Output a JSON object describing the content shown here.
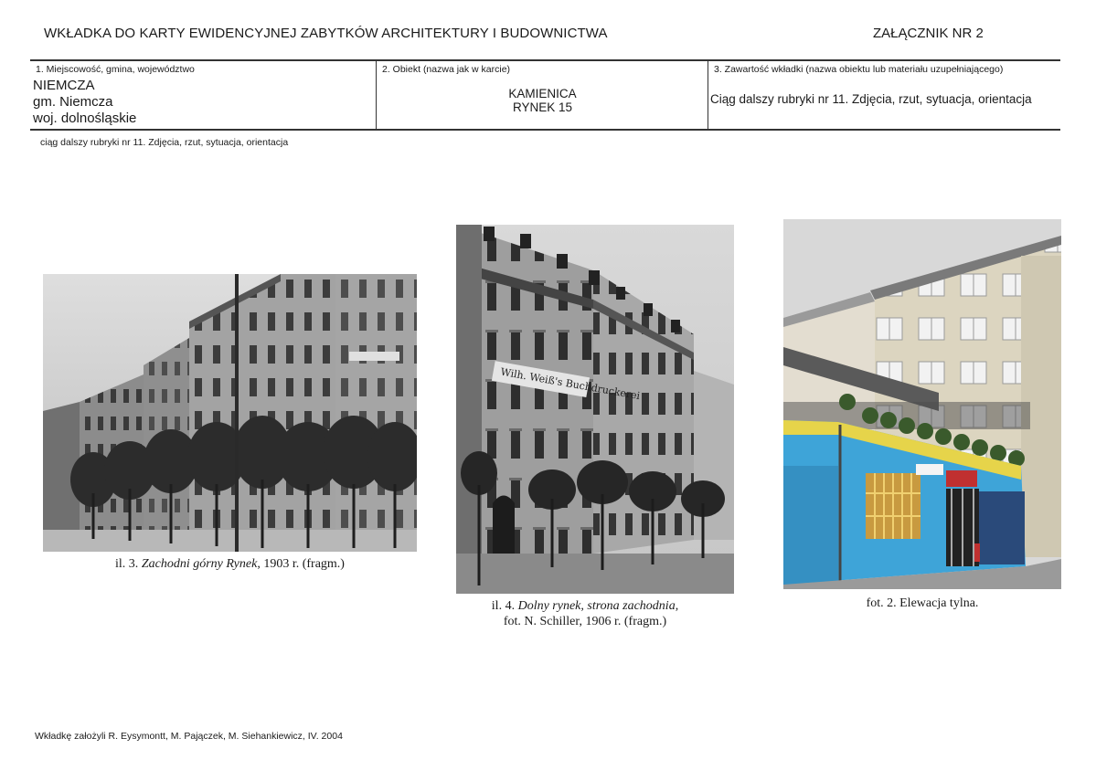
{
  "header": {
    "title": "WKŁADKA DO KARTY EWIDENCYJNEJ ZABYTKÓW ARCHITEKTURY I BUDOWNICTWA",
    "annex": "ZAŁĄCZNIK NR 2"
  },
  "table": {
    "col1": {
      "label": "1. Miejscowość, gmina, województwo",
      "lines": [
        "NIEMCZA",
        "gm. Niemcza",
        "woj. dolnośląskie"
      ]
    },
    "col2": {
      "label": "2. Obiekt (nazwa jak w karcie)",
      "lines": [
        "KAMIENICA",
        "RYNEK 15"
      ]
    },
    "col3": {
      "label": "3. Zawartość wkładki (nazwa obiektu lub materiału uzupełniającego)",
      "value": "Ciąg dalszy rubryki nr 11. Zdjęcia, rzut, sytuacja, orientacja"
    }
  },
  "subtitle": "ciąg dalszy rubryki nr 11. Zdjęcia, rzut, sytuacja, orientacja",
  "photos": [
    {
      "caption_prefix": "il. 3.",
      "caption_italic": "Zachodni górny Rynek",
      "caption_suffix": ", 1903 r. (fragm.)"
    },
    {
      "caption_prefix": "il. 4.",
      "caption_italic": "Dolny rynek, strona zachodnia",
      "caption_suffix": ",",
      "caption_line2": "fot. N. Schiller, 1906 r. (fragm.)",
      "sign_text": "Wilh. Weiß's Buchdruckerei"
    },
    {
      "caption": "fot. 2. Elewacja tylna."
    }
  ],
  "footer": "Wkładkę założyli R. Eysymontt, M. Pajączek, M. Siehankiewicz, IV. 2004"
}
